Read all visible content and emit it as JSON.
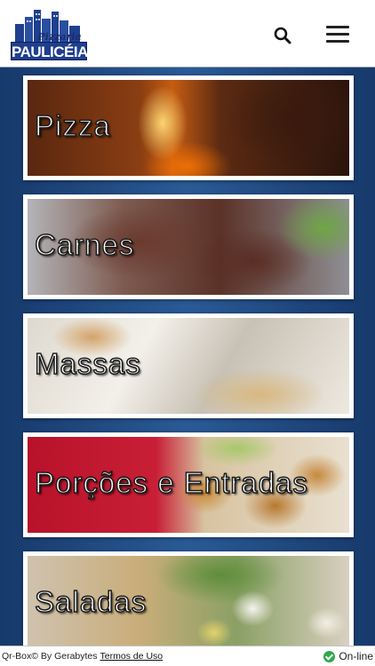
{
  "header": {
    "logo_name": "PAULICÉIA",
    "logo_sub": "Pizzaria",
    "search_icon": "search-icon",
    "menu_icon": "hamburger-menu-icon"
  },
  "categories": [
    {
      "label": "Pizza"
    },
    {
      "label": "Carnes"
    },
    {
      "label": "Massas"
    },
    {
      "label": "Porções e Entradas"
    },
    {
      "label": "Saladas"
    }
  ],
  "footer": {
    "copyright": "Qr-Box© By Gerabytes",
    "terms_link": "Termos de Uso",
    "status_text": "On-line",
    "status_color": "#2ea84a"
  }
}
